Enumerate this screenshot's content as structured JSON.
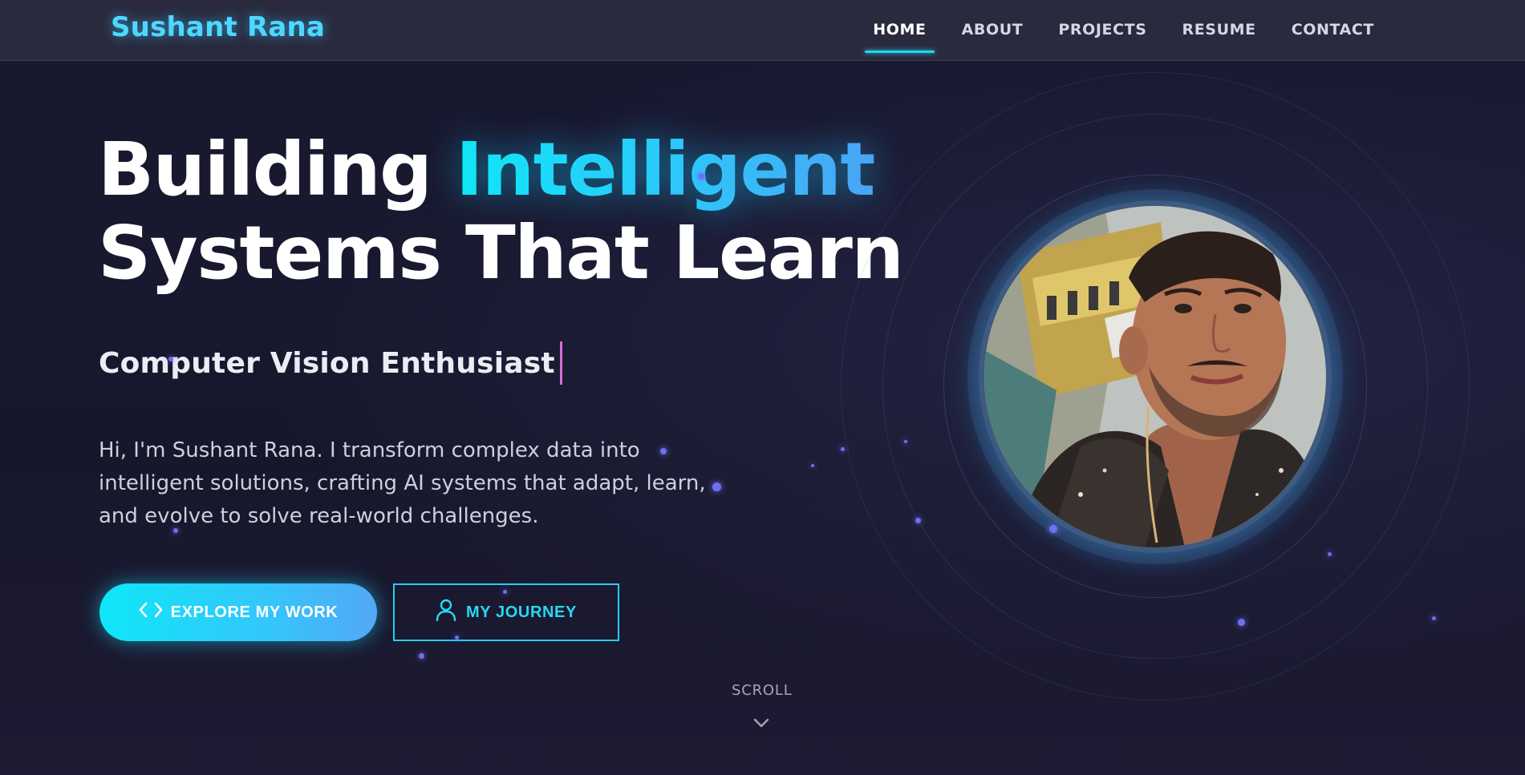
{
  "brand": "Sushant Rana",
  "nav": {
    "items": [
      {
        "label": "HOME",
        "active": true
      },
      {
        "label": "ABOUT",
        "active": false
      },
      {
        "label": "PROJECTS",
        "active": false
      },
      {
        "label": "RESUME",
        "active": false
      },
      {
        "label": "CONTACT",
        "active": false
      }
    ]
  },
  "hero": {
    "headline_line1_plain": "Building ",
    "headline_line1_accent": "Intelligent",
    "headline_line2": "Systems That Learn",
    "subtitle": "Computer Vision Enthusiast",
    "intro": "Hi, I'm Sushant Rana. I transform complex data into intelligent solutions, crafting AI systems that adapt, learn, and evolve to solve real-world challenges.",
    "primary_button": {
      "label": "EXPLORE MY WORK",
      "icon": "code-icon"
    },
    "secondary_button": {
      "label": "MY JOURNEY",
      "icon": "user-icon"
    },
    "scroll_label": "SCROLL",
    "avatar_alt": "profile photo"
  },
  "colors": {
    "accent": "#23d5ef",
    "brand": "#4fd8ff",
    "particle": "#6e6ff2",
    "caret": "#d76bd8",
    "background": "#17172c"
  }
}
